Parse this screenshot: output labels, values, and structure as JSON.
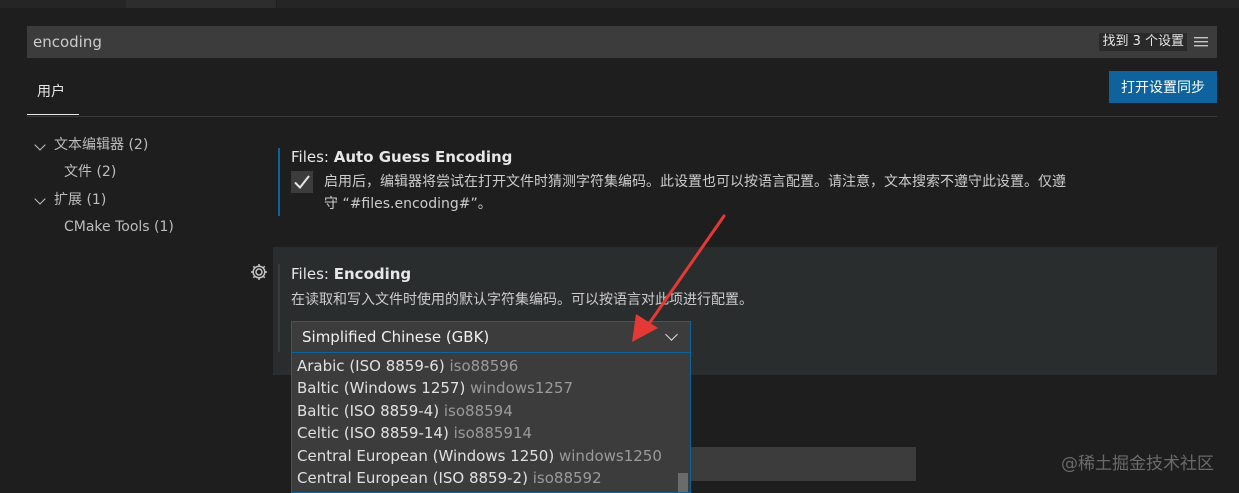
{
  "search": {
    "value": "encoding",
    "result_count": "找到 3 个设置"
  },
  "scope_tab": {
    "label": "用户"
  },
  "sync_button": {
    "label": "打开设置同步"
  },
  "toc": {
    "items": [
      {
        "label": "文本编辑器 (2)"
      },
      {
        "label": "文件 (2)"
      },
      {
        "label": "扩展 (1)"
      },
      {
        "label": "CMake Tools (1)"
      }
    ]
  },
  "settings": {
    "auto_guess": {
      "category": "Files: ",
      "name": "Auto Guess Encoding",
      "description_line1": "启用后，编辑器将尝试在打开文件时猜测字符集编码。此设置也可以按语言配置。请注意，文本搜索不遵守此设置。仅遵",
      "description_line2": "守 “#files.encoding#”。",
      "checked": true
    },
    "encoding": {
      "category": "Files: ",
      "name": "Encoding",
      "description": "在读取和写入文件时使用的默认字符集编码。可以按语言对此项进行配置。",
      "selected_value": "Simplified Chinese (GBK)",
      "options": [
        {
          "label": "Arabic (ISO 8859-6)",
          "id": "iso88596"
        },
        {
          "label": "Baltic (Windows 1257)",
          "id": "windows1257"
        },
        {
          "label": "Baltic (ISO 8859-4)",
          "id": "iso88594"
        },
        {
          "label": "Celtic (ISO 8859-14)",
          "id": "iso885914"
        },
        {
          "label": "Central European (Windows 1250)",
          "id": "windows1250"
        },
        {
          "label": "Central European (ISO 8859-2)",
          "id": "iso88592"
        }
      ]
    }
  },
  "watermark": "@稀土掘金技术社区",
  "colors": {
    "accent": "#0e639c",
    "annotation_arrow": "#e53935",
    "background": "#1e1e1e"
  },
  "icons": {
    "filter": "filter-icon",
    "gear": "gear-icon",
    "check": "check-icon",
    "chevron": "chevron-down-icon"
  }
}
